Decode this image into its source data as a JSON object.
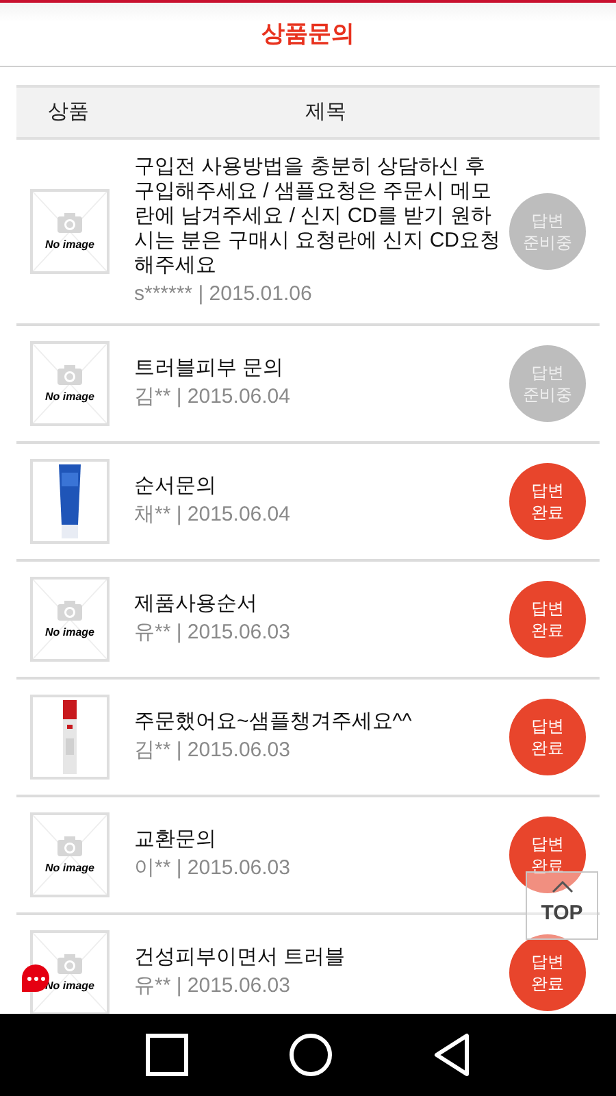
{
  "header": {
    "title": "상품문의"
  },
  "table": {
    "columns": [
      "상품",
      "제목"
    ],
    "rows": [
      {
        "thumb": {
          "kind": "no_image",
          "label": "No image"
        },
        "title": "구입전 사용방법을 충분히 상담하신 후 구입해주세요 / 샘플요청은 주문시 메모란에 남겨주세요 / 신지 CD를 받기 원하시는 분은 구매시 요청란에 신지 CD요청해주세요",
        "meta": "s****** | 2015.01.06",
        "status": {
          "kind": "pending",
          "line1": "답변",
          "line2": "준비중"
        }
      },
      {
        "thumb": {
          "kind": "no_image",
          "label": "No image"
        },
        "title": "트러블피부 문의",
        "meta": "김** | 2015.06.04",
        "status": {
          "kind": "pending",
          "line1": "답변",
          "line2": "준비중"
        }
      },
      {
        "thumb": {
          "kind": "tube"
        },
        "title": "순서문의",
        "meta": "채** | 2015.06.04",
        "status": {
          "kind": "done",
          "line1": "답변",
          "line2": "완료"
        }
      },
      {
        "thumb": {
          "kind": "no_image",
          "label": "No image"
        },
        "title": "제품사용순서",
        "meta": "유** | 2015.06.03",
        "status": {
          "kind": "done",
          "line1": "답변",
          "line2": "완료"
        }
      },
      {
        "thumb": {
          "kind": "bottle"
        },
        "title": "주문했어요~샘플챙겨주세요^^",
        "meta": "김** | 2015.06.03",
        "status": {
          "kind": "done",
          "line1": "답변",
          "line2": "완료"
        }
      },
      {
        "thumb": {
          "kind": "no_image",
          "label": "No image"
        },
        "title": "교환문의",
        "meta": "이** | 2015.06.03",
        "status": {
          "kind": "done",
          "line1": "답변",
          "line2": "완료"
        }
      },
      {
        "thumb": {
          "kind": "no_image",
          "label": "No image"
        },
        "title": "건성피부이면서 트러블",
        "meta": "유** | 2015.06.03",
        "status": {
          "kind": "done",
          "line1": "답변",
          "line2": "완료"
        }
      }
    ]
  },
  "top_button": {
    "label": "TOP"
  }
}
